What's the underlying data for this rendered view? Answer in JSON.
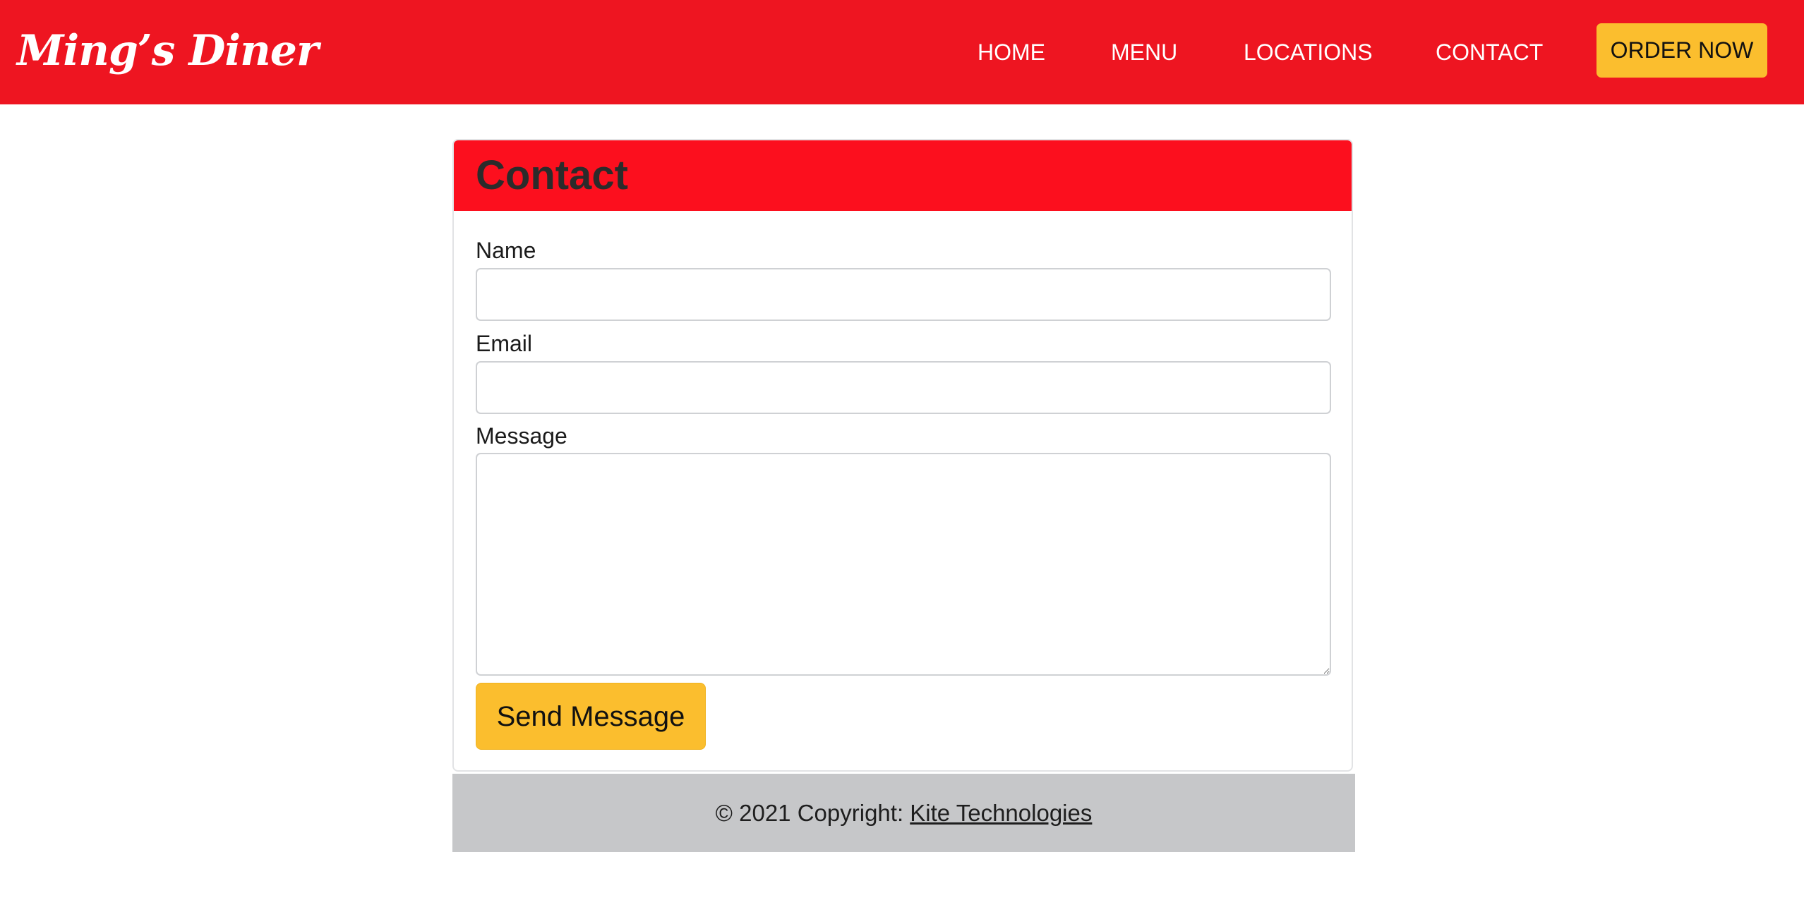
{
  "brand": {
    "name": "Ming’s Diner",
    "color": "#ee1521"
  },
  "nav": {
    "items": [
      {
        "label": "HOME"
      },
      {
        "label": "MENU"
      },
      {
        "label": "LOCATIONS"
      },
      {
        "label": "CONTACT"
      }
    ],
    "cta_label": "ORDER NOW",
    "cta_color": "#fbbe2e"
  },
  "contact": {
    "title": "Contact",
    "header_color": "#fc0f1e",
    "fields": {
      "name_label": "Name",
      "name_value": "",
      "email_label": "Email",
      "email_value": "",
      "message_label": "Message",
      "message_value": ""
    },
    "submit_label": "Send Message"
  },
  "footer": {
    "copyright_text": "© 2021 Copyright: ",
    "company_link": "Kite Technologies",
    "background": "#c6c7c9"
  }
}
